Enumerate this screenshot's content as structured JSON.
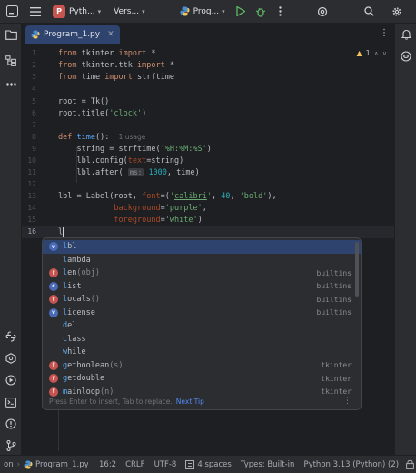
{
  "titlebar": {
    "project_badge": "P",
    "project_name": "Pyth...",
    "vcs_label": "Vers...",
    "run_config": "Prog..."
  },
  "tabs": [
    {
      "label": "Program_1.py",
      "active": true
    }
  ],
  "editor": {
    "line_numbers": [
      "1",
      "2",
      "3",
      "4",
      "5",
      "6",
      "7",
      "8",
      "9",
      "10",
      "11",
      "12",
      "13",
      "14",
      "15",
      "16"
    ],
    "warning_count": "1",
    "usage_hint": "1 usage",
    "inlay_ms": "ms:",
    "current_line_text": "l"
  },
  "completion": {
    "items": [
      {
        "name": "lbl",
        "args": "",
        "source": "",
        "icon": "v"
      },
      {
        "name": "lambda",
        "args": "",
        "source": "",
        "icon": "none"
      },
      {
        "name": "len",
        "args": "(obj)",
        "source": "builtins",
        "icon": "f"
      },
      {
        "name": "list",
        "args": "",
        "source": "builtins",
        "icon": "c"
      },
      {
        "name": "locals",
        "args": "()",
        "source": "builtins",
        "icon": "f"
      },
      {
        "name": "license",
        "args": "",
        "source": "builtins",
        "icon": "v"
      },
      {
        "name": "del",
        "args": "",
        "source": "",
        "icon": "none"
      },
      {
        "name": "class",
        "args": "",
        "source": "",
        "icon": "none"
      },
      {
        "name": "while",
        "args": "",
        "source": "",
        "icon": "none"
      },
      {
        "name": "getboolean",
        "args": "(s)",
        "source": "tkinter",
        "icon": "f"
      },
      {
        "name": "getdouble",
        "args": "",
        "source": "tkinter",
        "icon": "f"
      },
      {
        "name": "mainloop",
        "args": "(n)",
        "source": "tkinter",
        "icon": "f"
      }
    ],
    "footer_text": "Press Enter to insert, Tab to replace.",
    "footer_link": "Next Tip"
  },
  "statusbar": {
    "project_fragment": "on",
    "file": "Program_1.py",
    "position": "16:2",
    "line_sep": "CRLF",
    "encoding": "UTF-8",
    "indent": "4 spaces",
    "types": "Types: Built-in",
    "interpreter": "Python 3.13 (Python) (2)"
  },
  "colors": {
    "accent": "#2e436e",
    "background": "#1e1f22",
    "panel": "#2b2d30"
  }
}
